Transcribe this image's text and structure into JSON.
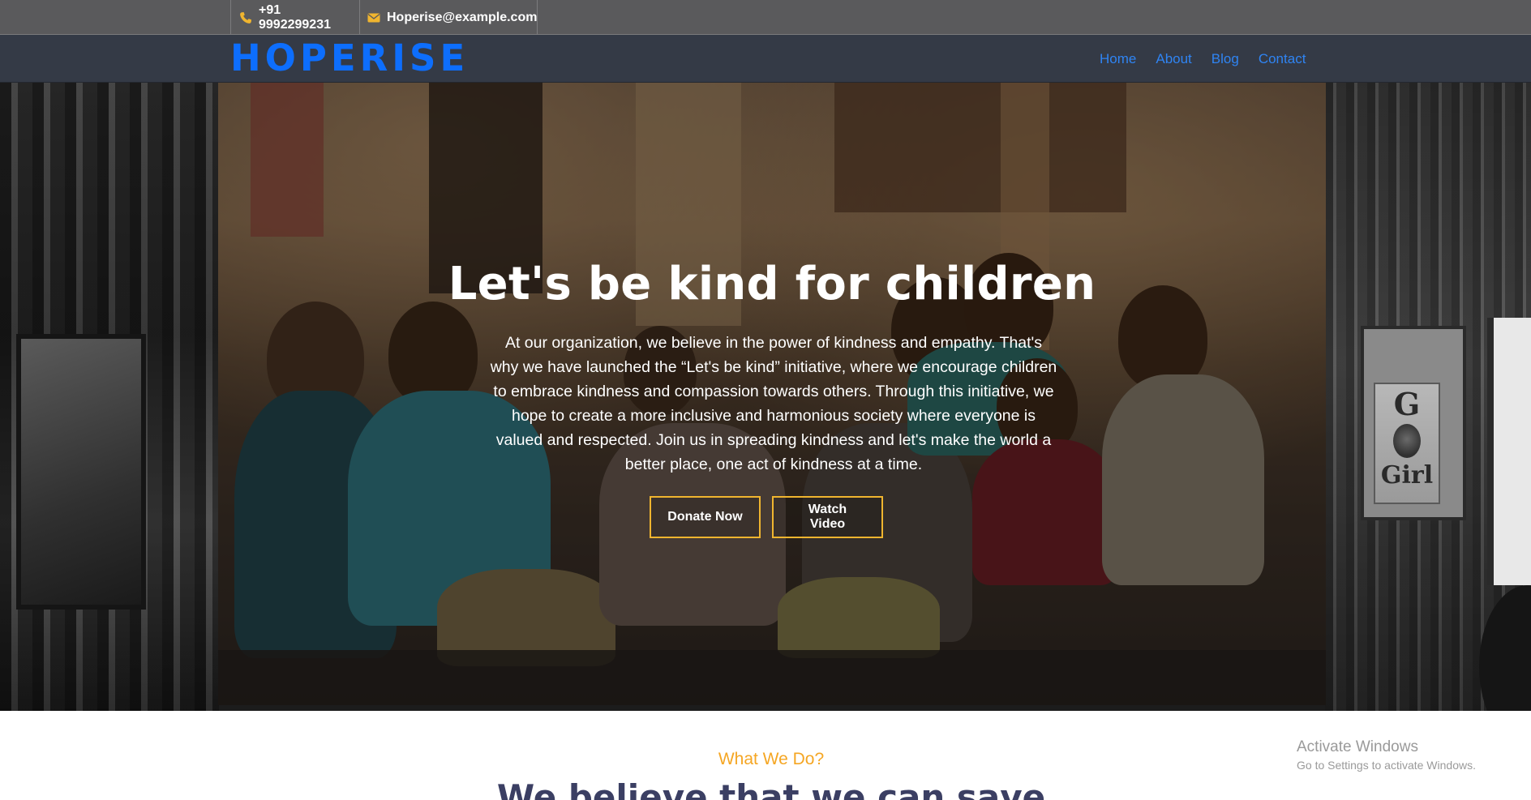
{
  "topbar": {
    "phone": "+91 9992299231",
    "email": "Hoperise@example.com",
    "phone_icon": "phone-icon",
    "email_icon": "envelope-icon"
  },
  "navbar": {
    "logo": "HOPERISE",
    "links": [
      "Home",
      "About",
      "Blog",
      "Contact"
    ]
  },
  "hero": {
    "title": "Let's be kind for children",
    "text": "At our organization, we believe in the power of kindness and empathy. That's why we have launched the “Let's be kind” initiative, where we encourage children to embrace kindness and compassion towards others. Through this initiative, we hope to create a more inclusive and harmonious society where everyone is valued and respected. Join us in spreading kindness and let's make the world a better place, one act of kindness at a time.",
    "donate_label": "Donate Now",
    "watch_label": "Watch Video",
    "background_poster_text": {
      "letter": "G",
      "word": "Girl"
    }
  },
  "section": {
    "subtitle": "What We Do?",
    "heading": "We believe that we can save"
  },
  "watermark": {
    "line1": "Activate Windows",
    "line2": "Go to Settings to activate Windows."
  },
  "colors": {
    "topbar_bg": "#5a5a5c",
    "navbar_bg": "#343a46",
    "logo": "#0d6efd",
    "nav_link": "#2f84f3",
    "button_border": "#f0b52f",
    "icon_accent": "#f0b52f",
    "subtitle": "#f5a623",
    "heading": "#3b3f63"
  }
}
